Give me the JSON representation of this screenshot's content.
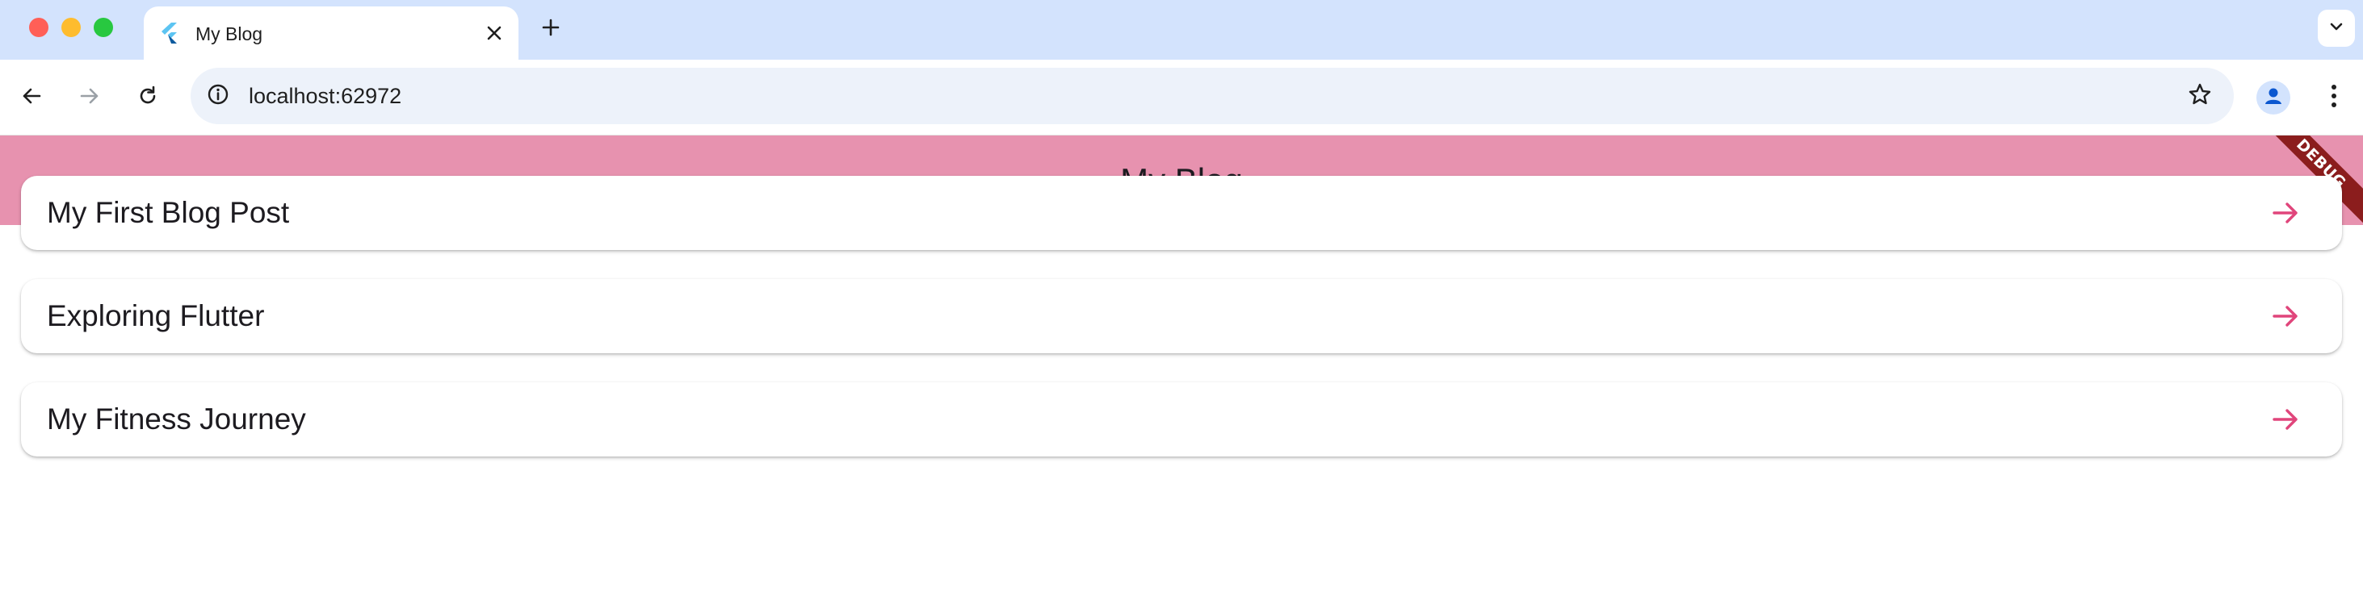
{
  "browser": {
    "tab_title": "My Blog",
    "url": "localhost:62972",
    "icons": {
      "favicon": "flutter-logo-icon",
      "tab_close": "close-icon",
      "new_tab": "plus-icon",
      "tab_search": "chevron-down-icon",
      "back": "arrow-left-icon",
      "forward": "arrow-right-icon",
      "reload": "reload-icon",
      "site_info": "info-icon",
      "bookmark": "star-icon",
      "profile": "person-icon",
      "menu": "kebab-menu-icon"
    }
  },
  "app": {
    "title": "My Blog",
    "debug_banner": "DEBUG",
    "posts": [
      {
        "title": "My First Blog Post"
      },
      {
        "title": "Exploring Flutter"
      },
      {
        "title": "My Fitness Journey"
      }
    ],
    "colors": {
      "appbar": "#e792af",
      "accent": "#e0457b",
      "debug_banner": "#8b1d1d"
    }
  }
}
